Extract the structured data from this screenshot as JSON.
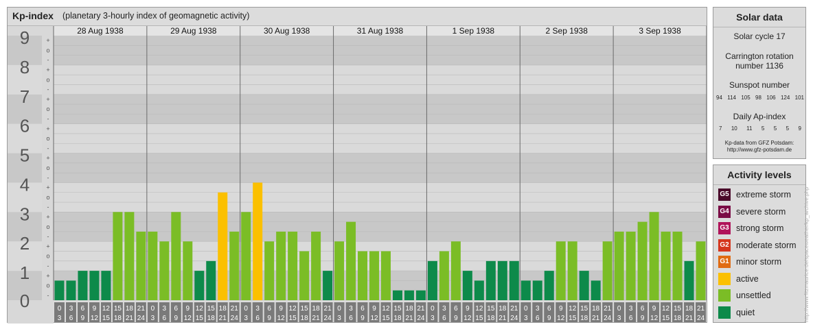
{
  "title": "Kp-index",
  "subtitle": "(planetary 3-hourly index of geomagnetic activity)",
  "chart_data": {
    "type": "bar",
    "days": [
      "28 Aug 1938",
      "29 Aug 1938",
      "30 Aug 1938",
      "31 Aug 1938",
      "1 Sep 1938",
      "2 Sep 1938",
      "3 Sep 1938"
    ],
    "interval_labels": [
      [
        "0",
        "3"
      ],
      [
        "3",
        "6"
      ],
      [
        "6",
        "9"
      ],
      [
        "9",
        "12"
      ],
      [
        "12",
        "15"
      ],
      [
        "15",
        "18"
      ],
      [
        "18",
        "21"
      ],
      [
        "21",
        "24"
      ]
    ],
    "y_labels": [
      "0",
      "1",
      "2",
      "3",
      "4",
      "5",
      "6",
      "7",
      "8",
      "9"
    ],
    "y_sub_labels": [
      "-",
      "o",
      "+"
    ],
    "ylim": [
      0,
      9
    ],
    "values": [
      0.667,
      0.667,
      1.0,
      1.0,
      1.0,
      3.0,
      3.0,
      2.333,
      2.333,
      2.0,
      3.0,
      2.0,
      1.0,
      1.333,
      3.667,
      2.333,
      3.0,
      4.0,
      2.0,
      2.333,
      2.333,
      1.667,
      2.333,
      1.0,
      2.0,
      2.667,
      1.667,
      1.667,
      1.667,
      0.333,
      0.333,
      0.333,
      1.333,
      1.667,
      2.0,
      1.0,
      0.667,
      1.333,
      1.333,
      1.333,
      0.667,
      0.667,
      1.0,
      2.0,
      2.0,
      1.0,
      0.667,
      2.0,
      2.333,
      2.333,
      2.667,
      3.0,
      2.333,
      2.333,
      1.333,
      2.0
    ],
    "colors": {
      "quiet": "#0d8a4a",
      "unsettled": "#7bbd26",
      "active": "#fbc000",
      "band_dark": "#c8c8c8",
      "band_light": "#dadada",
      "slot": "#7a7a7a"
    }
  },
  "solar": {
    "heading": "Solar data",
    "cycle": "Solar cycle 17",
    "carrington": "Carrington rotation number 1136",
    "sunspot_title": "Sunspot number",
    "sunspot_values": [
      "94",
      "114",
      "105",
      "98",
      "106",
      "124",
      "101"
    ],
    "ap_title": "Daily Ap-index",
    "ap_values": [
      "7",
      "10",
      "11",
      "5",
      "5",
      "5",
      "9"
    ],
    "source_line1": "Kp-data from GFZ Potsdam:",
    "source_line2": "http://www.gfz-potsdam.de"
  },
  "activity": {
    "heading": "Activity levels",
    "items": [
      {
        "code": "G5",
        "label": "extreme storm",
        "color": "#4a0a2a"
      },
      {
        "code": "G4",
        "label": "severe storm",
        "color": "#7a0c45"
      },
      {
        "code": "G3",
        "label": "strong storm",
        "color": "#b0145a"
      },
      {
        "code": "G2",
        "label": "moderate storm",
        "color": "#d5361e"
      },
      {
        "code": "G1",
        "label": "minor storm",
        "color": "#e06b12"
      },
      {
        "code": "",
        "label": "active",
        "color": "#fbc000"
      },
      {
        "code": "",
        "label": "unsettled",
        "color": "#7bbd26"
      },
      {
        "code": "",
        "label": "quiet",
        "color": "#0d8a4a"
      }
    ]
  },
  "watermark": "http://www.fitzmaurice.de/spaceweather/kp_archive.php"
}
